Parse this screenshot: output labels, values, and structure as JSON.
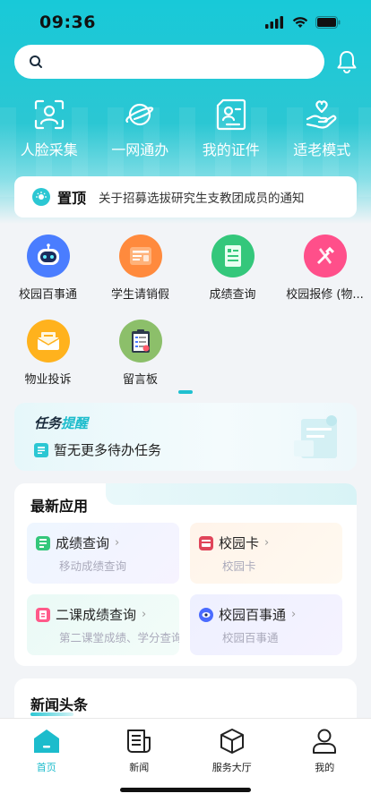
{
  "status_bar": {
    "time": "09:36"
  },
  "search": {
    "placeholder": ""
  },
  "quick_actions": [
    {
      "label": "人脸采集",
      "icon": "face-scan-icon"
    },
    {
      "label": "一网通办",
      "icon": "planet-icon"
    },
    {
      "label": "我的证件",
      "icon": "id-card-icon"
    },
    {
      "label": "适老模式",
      "icon": "hand-heart-icon"
    }
  ],
  "notice": {
    "tag": "置顶",
    "text": "关于招募选拔研究生支教团成员的通知"
  },
  "apps": [
    {
      "label": "校园百事通",
      "icon": "robot-icon",
      "color": "#4a7dff"
    },
    {
      "label": "学生请销假",
      "icon": "leave-form-icon",
      "color": "#ff8a3d"
    },
    {
      "label": "成绩查询",
      "icon": "grade-report-icon",
      "color": "#34c77b"
    },
    {
      "label": "校园报修 (物...",
      "icon": "repair-tools-icon",
      "color": "#ff4f8a"
    },
    {
      "label": "物业投诉",
      "icon": "mail-icon",
      "color": "#ffb21d"
    },
    {
      "label": "留言板",
      "icon": "clipboard-icon",
      "color": "#8cbf6a"
    }
  ],
  "task": {
    "title_part1": "任务",
    "title_part2": "提醒",
    "status": "暂无更多待办任务"
  },
  "latest_apps": {
    "title": "最新应用",
    "items": [
      {
        "name": "成绩查询",
        "sub": "移动成绩查询",
        "icon": "grade-icon",
        "color": "#34c77b"
      },
      {
        "name": "校园卡",
        "sub": "校园卡",
        "icon": "campus-card-icon",
        "color": "#e0455a"
      },
      {
        "name": "二课成绩查询",
        "sub": "第二课堂成绩、学分查询",
        "icon": "second-class-icon",
        "color": "#ff5a8a"
      },
      {
        "name": "校园百事通",
        "sub": "校园百事通",
        "icon": "eye-robot-icon",
        "color": "#4a6bff"
      }
    ]
  },
  "news": {
    "title": "新闻头条"
  },
  "tabs": [
    {
      "label": "首页",
      "icon": "home-icon",
      "active": true
    },
    {
      "label": "新闻",
      "icon": "news-icon",
      "active": false
    },
    {
      "label": "服务大厅",
      "icon": "service-cube-icon",
      "active": false
    },
    {
      "label": "我的",
      "icon": "profile-icon",
      "active": false
    }
  ],
  "colors": {
    "accent": "#1cbccc",
    "header": "#18c9d8"
  }
}
